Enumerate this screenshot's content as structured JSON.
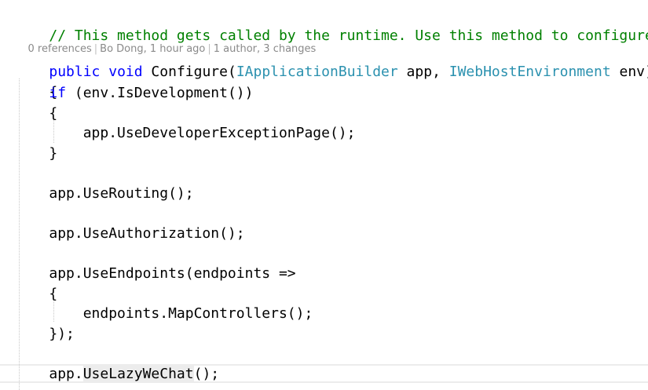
{
  "editor": {
    "comment": "// This method gets called by the runtime. Use this method to configure th",
    "codelens": {
      "references": "0 references",
      "author_time": "Bo Dong, 1 hour ago",
      "changes": "1 author, 3 changes"
    },
    "signature": {
      "kw_public": "public",
      "kw_void": "void",
      "method": " Configure(",
      "type1": "IApplicationBuilder",
      "param1": " app, ",
      "type2": "IWebHostEnvironment",
      "param2": " env)"
    },
    "brace_open": "{",
    "if_kw": "if",
    "if_cond": " (env.IsDevelopment())",
    "if_brace_open": "{",
    "dev_exception": "app.UseDeveloperExceptionPage();",
    "if_brace_close": "}",
    "use_routing": "app.UseRouting();",
    "use_authorization": "app.UseAuthorization();",
    "use_endpoints": "app.UseEndpoints(endpoints =>",
    "lambda_brace_open": "{",
    "map_controllers": "endpoints.MapControllers();",
    "lambda_close": "});",
    "lazy_prefix": "app.",
    "lazy_method": "UseLazyWeChat",
    "lazy_suffix": "();"
  }
}
